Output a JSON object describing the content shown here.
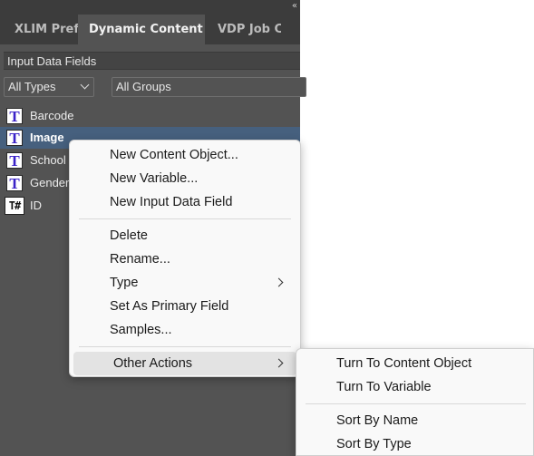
{
  "panel": {
    "collapse_icon": "«",
    "tabs": [
      {
        "label": "XLIM Pref"
      },
      {
        "label": "Dynamic Content"
      },
      {
        "label": "VDP Job C"
      }
    ],
    "header": "Input Data Fields",
    "filters": {
      "types": "All Types",
      "groups": "All Groups"
    },
    "fields": [
      {
        "label": "Barcode",
        "icon": "text-field-icon"
      },
      {
        "label": "Image",
        "icon": "text-field-icon",
        "selected": true
      },
      {
        "label": "School",
        "icon": "text-field-icon"
      },
      {
        "label": "Gender",
        "icon": "text-field-icon"
      },
      {
        "label": "ID",
        "icon": "number-field-icon"
      }
    ],
    "icon_glyphs": {
      "text": "T",
      "number": "T#"
    }
  },
  "context_menu": {
    "items": [
      "New Content Object...",
      "New Variable...",
      "New Input Data Field",
      "Delete",
      "Rename...",
      "Type",
      "Set As Primary Field",
      "Samples...",
      "Other Actions"
    ]
  },
  "submenu": {
    "items": [
      "Turn To Content Object",
      "Turn To Variable",
      "Sort By Name",
      "Sort By Type"
    ]
  },
  "colors": {
    "panel_bg": "#535353",
    "tabbar_bg": "#3c3c3c",
    "selected_row": "#46607e",
    "icon_glyph": "#3a22c8",
    "menu_bg": "#f9f9f9",
    "menu_hover": "#e3e3e3"
  }
}
